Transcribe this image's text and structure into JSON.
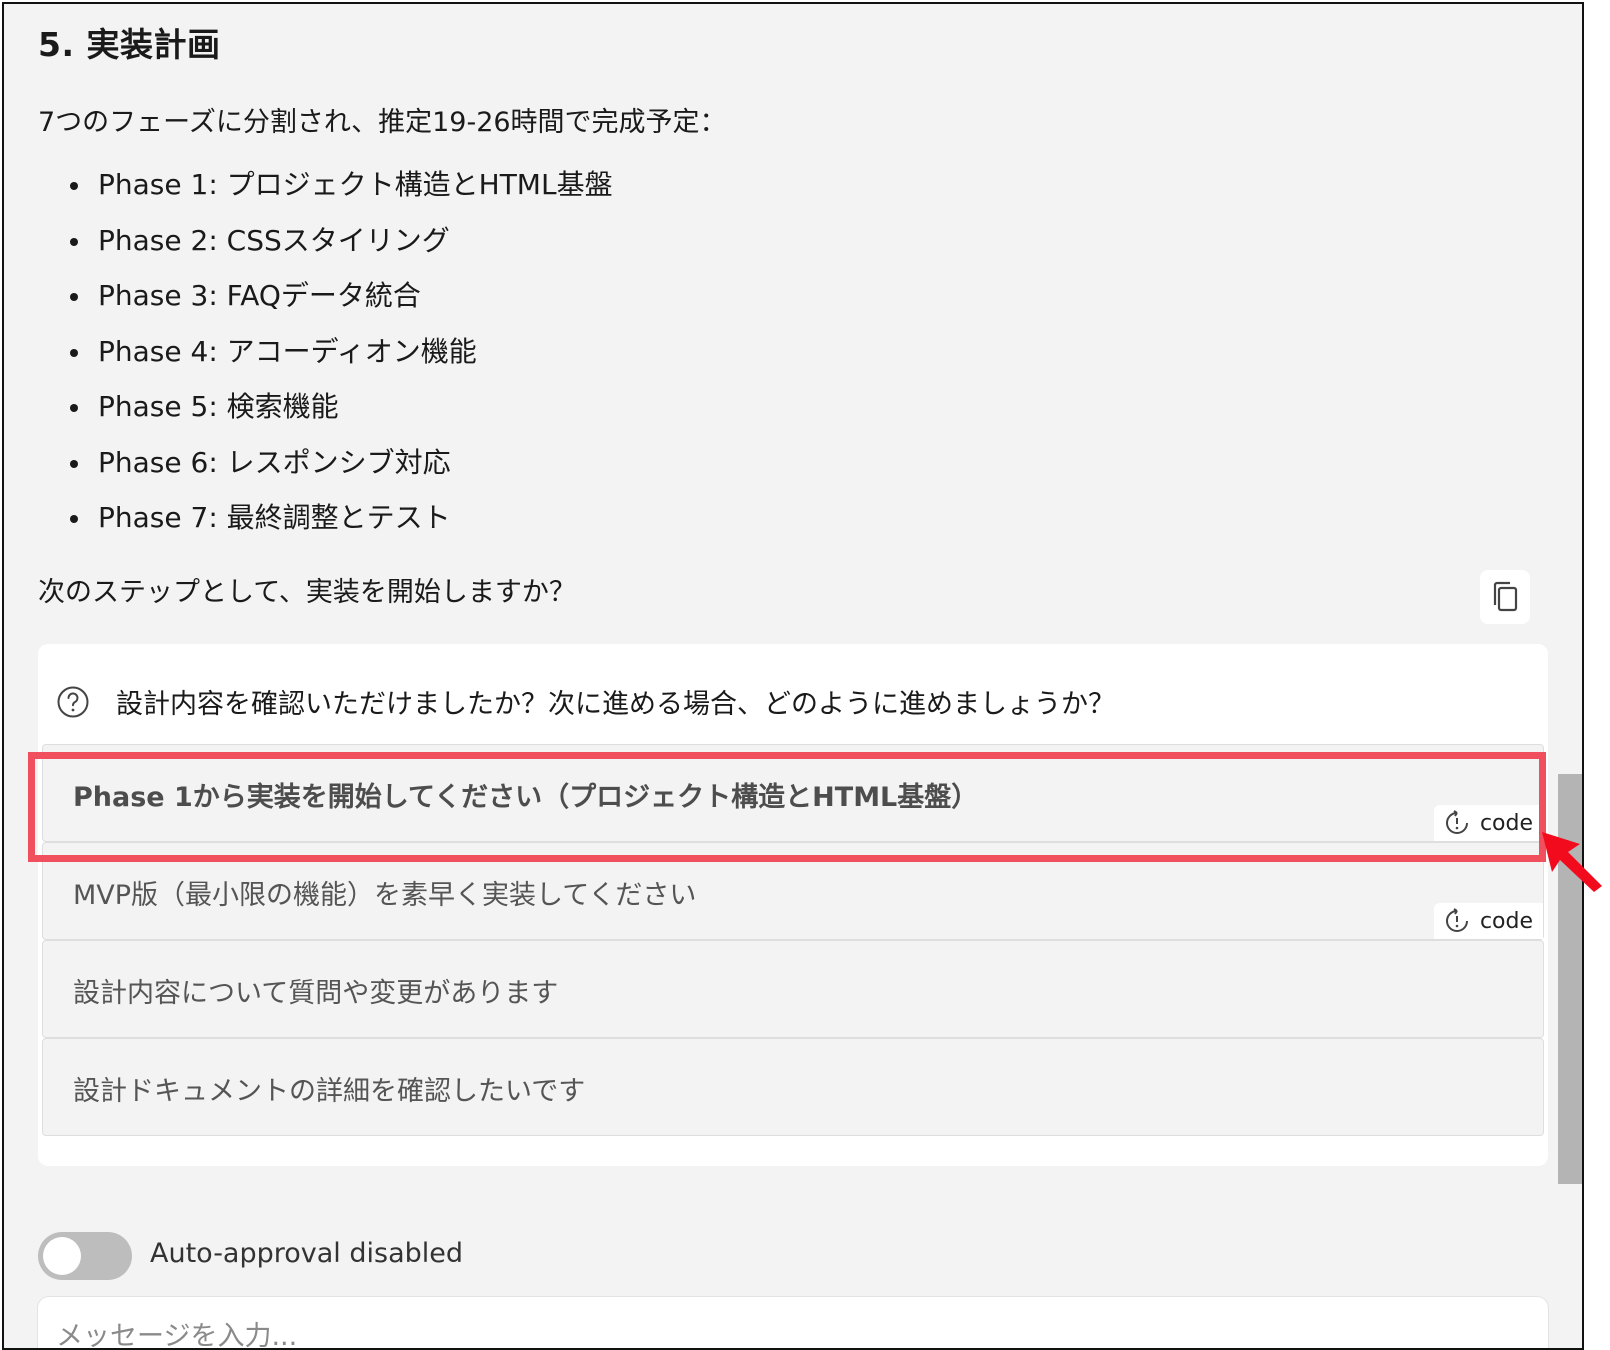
{
  "heading": "5. 実装計画",
  "intro": "7つのフェーズに分割され、推定19-26時間で完成予定：",
  "phases": [
    "Phase 1: プロジェクト構造とHTML基盤",
    "Phase 2: CSSスタイリング",
    "Phase 3: FAQデータ統合",
    "Phase 4: アコーディオン機能",
    "Phase 5: 検索機能",
    "Phase 6: レスポンシブ対応",
    "Phase 7: 最終調整とテスト"
  ],
  "next_step": "次のステップとして、実装を開始しますか？",
  "question": {
    "icon": "question-circle-icon",
    "text": "設計内容を確認いただけましたか？次に進める場合、どのように進めましょうか？"
  },
  "options": [
    {
      "label": "Phase 1から実装を開始してください（プロジェクト構造とHTML基盤）",
      "tag": "code",
      "highlighted": true
    },
    {
      "label": "MVP版（最小限の機能）を素早く実装してください",
      "tag": "code"
    },
    {
      "label": "設計内容について質問や変更があります"
    },
    {
      "label": "設計ドキュメントの詳細を確認したいです"
    }
  ],
  "auto_approval": {
    "label": "Auto-approval disabled",
    "enabled": false
  },
  "message_input": {
    "placeholder": "メッセージを入力..."
  },
  "colors": {
    "highlight": "#f0505d",
    "background": "#f3f3f3",
    "arrow": "#f20b1c"
  }
}
